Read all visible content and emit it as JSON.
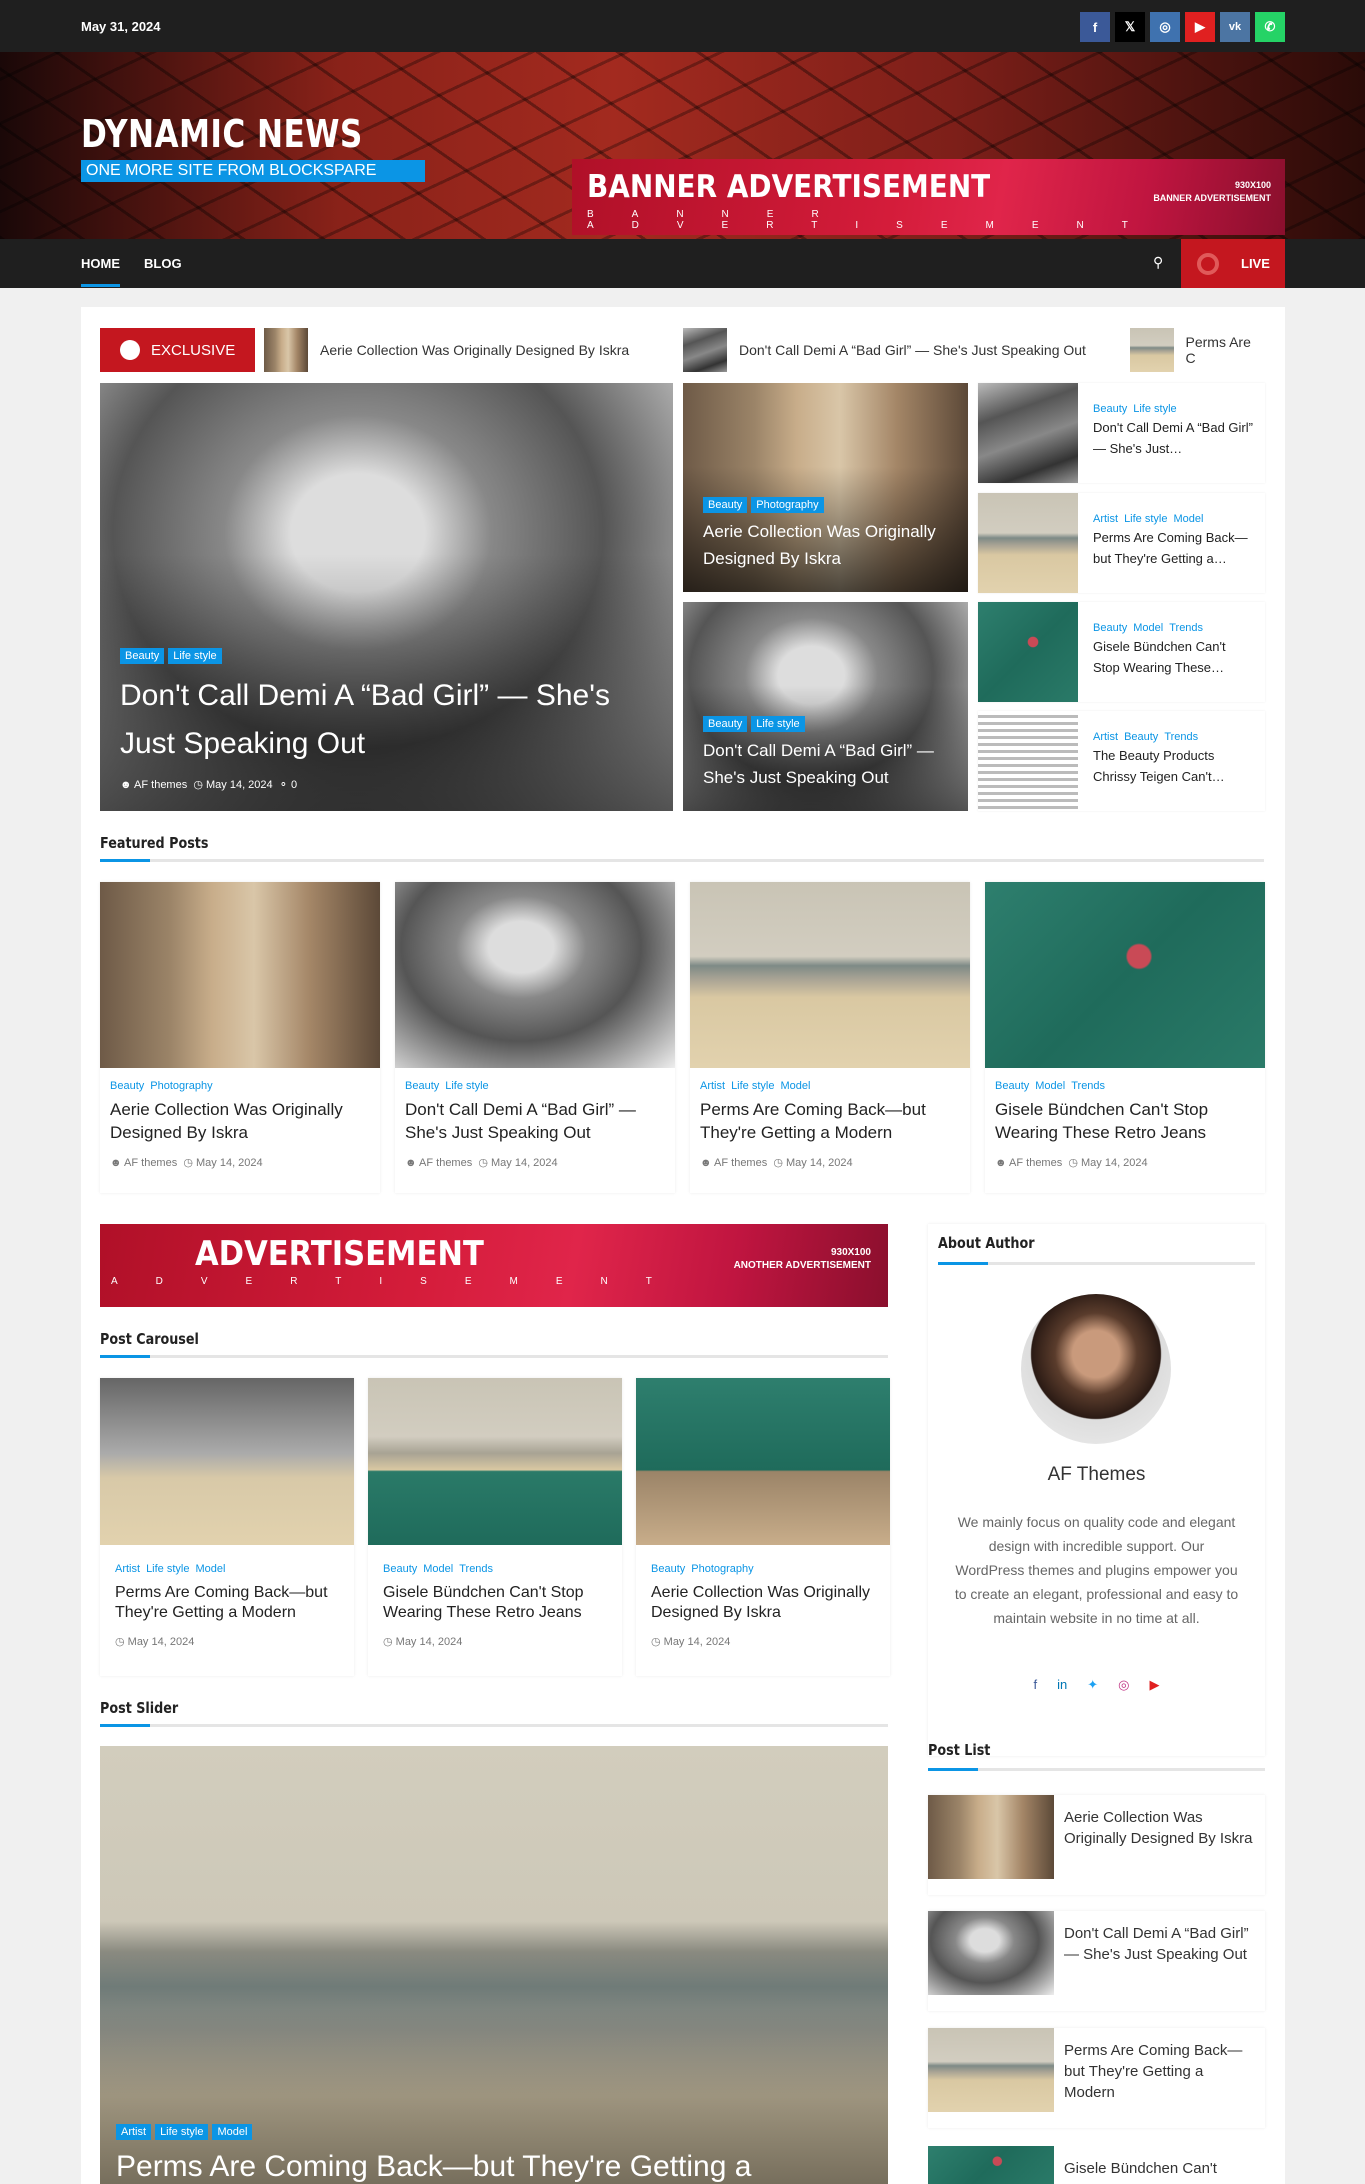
{
  "topbar": {
    "date": "May 31, 2024",
    "social": [
      {
        "icon": "facebook-icon",
        "glyph": "f",
        "color": "#3b5998"
      },
      {
        "icon": "x-icon",
        "glyph": "𝕏",
        "color": "#000000"
      },
      {
        "icon": "instagram-icon",
        "glyph": "◎",
        "color": "#3f72af"
      },
      {
        "icon": "youtube-icon",
        "glyph": "▶",
        "color": "#e02020"
      },
      {
        "icon": "vk-icon",
        "glyph": "vk",
        "color": "#4c75a3"
      },
      {
        "icon": "whatsapp-icon",
        "glyph": "✆",
        "color": "#25d366"
      }
    ]
  },
  "header": {
    "site_name": "DYNAMIC NEWS",
    "tagline": "ONE MORE SITE FROM BLOCKSPARE",
    "banner": {
      "title": "BANNER ADVERTISEMENT",
      "spaced": "BANNER ADVERTISEMENT",
      "size": "930X100",
      "size_label": "BANNER ADVERTISEMENT"
    }
  },
  "nav": {
    "items": [
      "HOME",
      "BLOG"
    ],
    "live": "LIVE"
  },
  "ticker": {
    "label": "EXCLUSIVE",
    "items": [
      "Aerie Collection Was Originally Designed By Iskra",
      "Don't Call Demi A “Bad Girl” — She's Just Speaking Out",
      "Perms Are C"
    ]
  },
  "hero": {
    "tags": [
      "Beauty",
      "Life style"
    ],
    "title": "Don't Call Demi A “Bad Girl” — She's Just Speaking Out",
    "author": "AF themes",
    "date": "May 14, 2024",
    "comments": "0"
  },
  "mid": [
    {
      "tags": [
        "Beauty",
        "Photography"
      ],
      "title": "Aerie Collection Was Originally Designed By Iskra"
    },
    {
      "tags": [
        "Beauty",
        "Life style"
      ],
      "title": "Don't Call Demi A “Bad Girl” — She's Just Speaking Out"
    }
  ],
  "side": [
    {
      "cats": [
        "Beauty",
        "Life style"
      ],
      "title": "Don't Call Demi A “Bad Girl” — She's Just…"
    },
    {
      "cats": [
        "Artist",
        "Life style",
        "Model"
      ],
      "title": "Perms Are Coming Back—but They're Getting a…"
    },
    {
      "cats": [
        "Beauty",
        "Model",
        "Trends"
      ],
      "title": "Gisele Bündchen Can't Stop Wearing These…"
    },
    {
      "cats": [
        "Artist",
        "Beauty",
        "Trends"
      ],
      "title": "The Beauty Products Chrissy Teigen Can't…"
    }
  ],
  "featured": {
    "heading": "Featured Posts",
    "posts": [
      {
        "cats": [
          "Beauty",
          "Photography"
        ],
        "title": "Aerie Collection Was Originally Designed By Iskra",
        "author": "AF themes",
        "date": "May 14, 2024"
      },
      {
        "cats": [
          "Beauty",
          "Life style"
        ],
        "title": "Don't Call Demi A “Bad Girl” — She's Just Speaking Out",
        "author": "AF themes",
        "date": "May 14, 2024"
      },
      {
        "cats": [
          "Artist",
          "Life style",
          "Model"
        ],
        "title": "Perms Are Coming Back—but They're Getting a Modern",
        "author": "AF themes",
        "date": "May 14, 2024"
      },
      {
        "cats": [
          "Beauty",
          "Model",
          "Trends"
        ],
        "title": "Gisele Bündchen Can't Stop Wearing These Retro Jeans",
        "author": "AF themes",
        "date": "May 14, 2024"
      }
    ]
  },
  "ad2": {
    "title": "ADVERTISEMENT",
    "spaced": "ADVERTISEMENT",
    "size": "930X100",
    "size_label": "ANOTHER ADVERTISEMENT"
  },
  "carousel": {
    "heading": "Post Carousel",
    "posts": [
      {
        "cats": [
          "Artist",
          "Life style",
          "Model"
        ],
        "title": "Perms Are Coming Back—but They're Getting a Modern",
        "date": "May 14, 2024"
      },
      {
        "cats": [
          "Beauty",
          "Model",
          "Trends"
        ],
        "title": "Gisele Bündchen Can't Stop Wearing These Retro Jeans",
        "date": "May 14, 2024"
      },
      {
        "cats": [
          "Beauty",
          "Photography"
        ],
        "title": "Aerie Collection Was Originally Designed By Iskra",
        "date": "May 14, 2024"
      }
    ]
  },
  "slider": {
    "heading": "Post Slider",
    "tags": [
      "Artist",
      "Life style",
      "Model"
    ],
    "title": "Perms Are Coming Back—but They're Getting a"
  },
  "author": {
    "heading": "About Author",
    "name": "AF Themes",
    "bio": "We mainly focus on quality code and elegant design with incredible support. Our WordPress themes and plugins empower you to create an elegant, professional and easy to maintain website in no time at all."
  },
  "postlist": {
    "heading": "Post List",
    "items": [
      "Aerie Collection Was Originally Designed By Iskra",
      "Don't Call Demi A “Bad Girl” — She's Just Speaking Out",
      "Perms Are Coming Back—but They're Getting a Modern",
      "Gisele Bündchen Can't"
    ]
  }
}
